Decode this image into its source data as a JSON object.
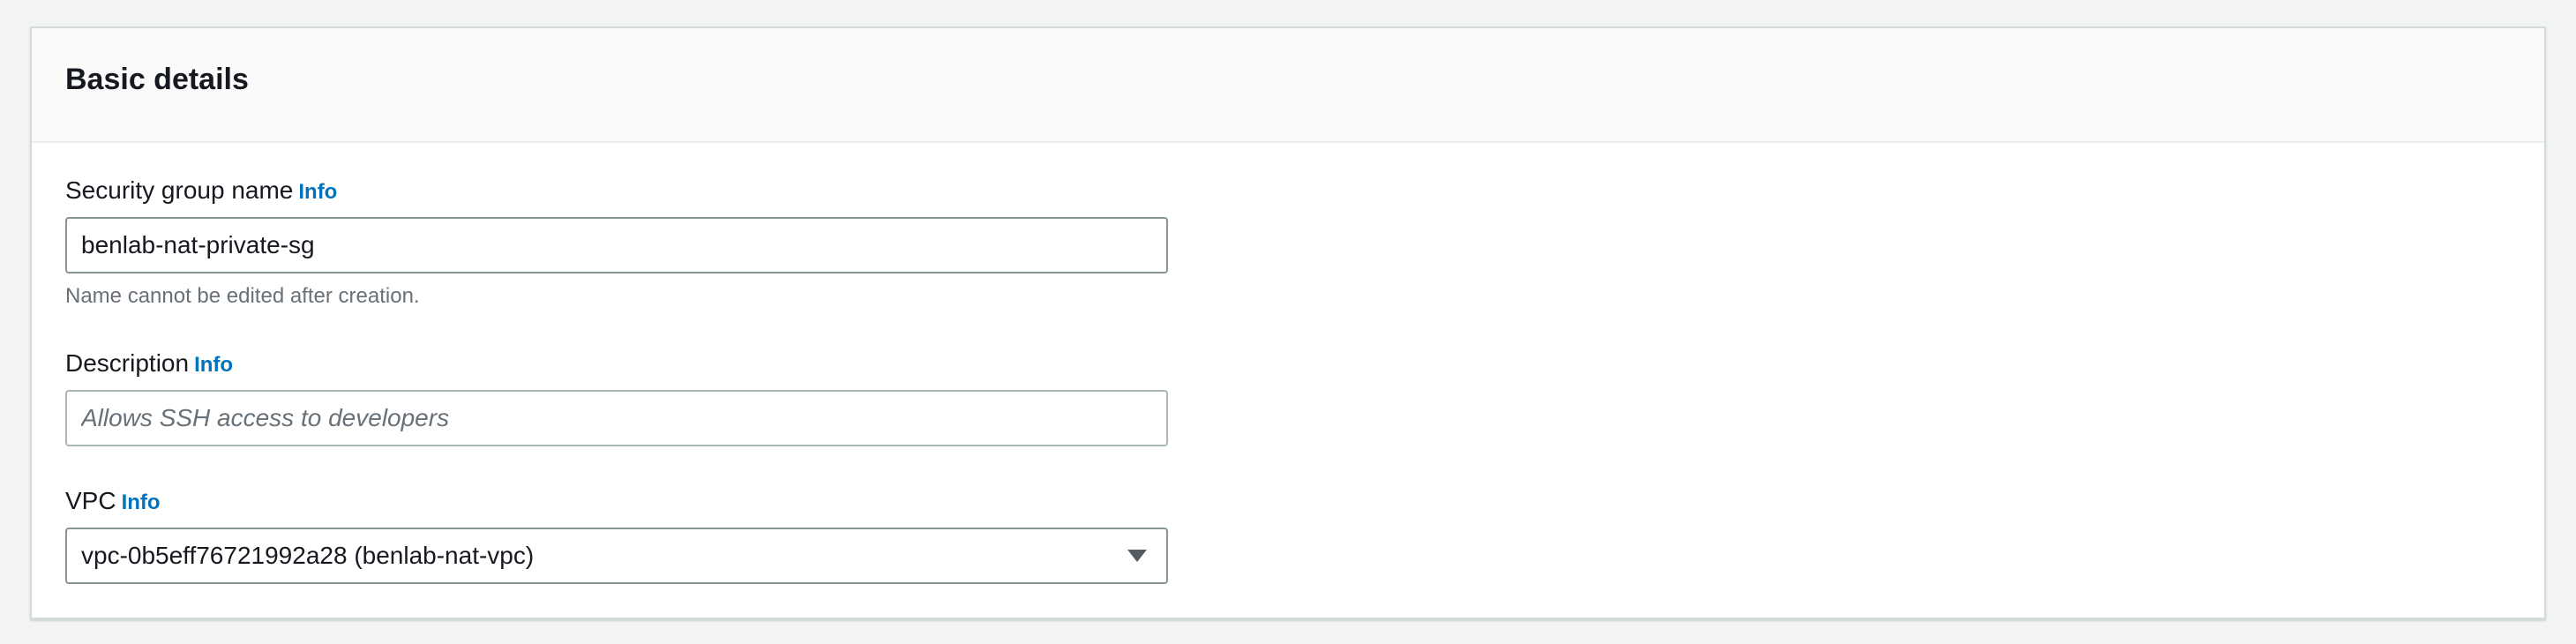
{
  "section": {
    "title": "Basic details"
  },
  "fields": {
    "name": {
      "label": "Security group name",
      "info": "Info",
      "value": "benlab-nat-private-sg",
      "help": "Name cannot be edited after creation."
    },
    "description": {
      "label": "Description",
      "info": "Info",
      "placeholder": "Allows SSH access to developers",
      "value": ""
    },
    "vpc": {
      "label": "VPC",
      "info": "Info",
      "selected": "vpc-0b5eff76721992a28 (benlab-nat-vpc)"
    }
  },
  "icons": {
    "vpc_dropdown": "caret-down-icon"
  },
  "colors": {
    "info_link": "#0073bb",
    "page_bg": "#f2f3f3",
    "header_bg": "#fafafa",
    "help_text": "#687078"
  }
}
